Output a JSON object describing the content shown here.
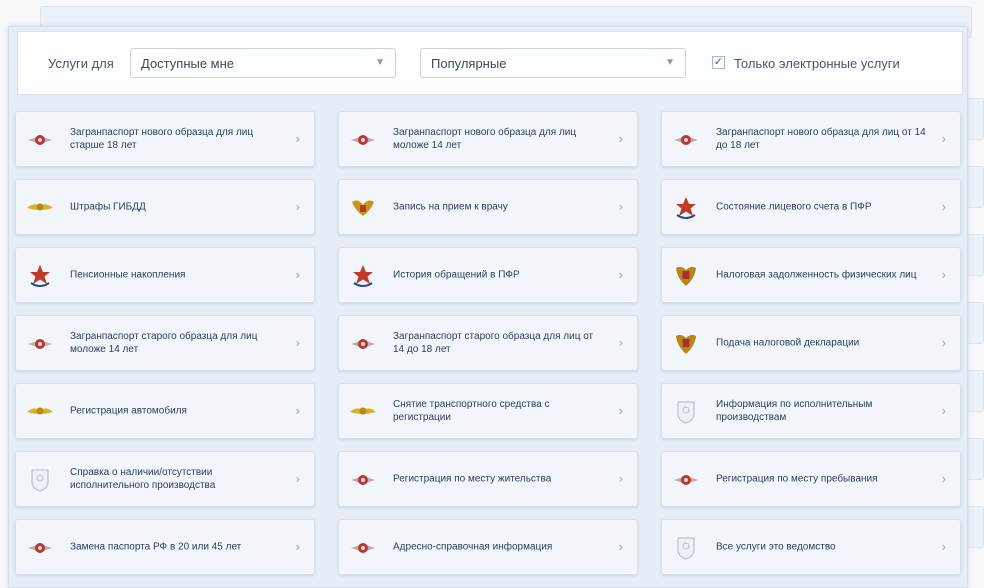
{
  "filter": {
    "label": "Услуги для",
    "audience": "Доступные мне",
    "sort": "Популярные",
    "electronic_only_checked": true,
    "electronic_only_label": "Только электронные услуги"
  },
  "services": [
    {
      "label": "Загранпаспорт нового образца для лиц старше 18 лет",
      "icon": "fms-emblem-icon"
    },
    {
      "label": "Загранпаспорт нового образца для лиц моложе 14 лет",
      "icon": "fms-emblem-icon"
    },
    {
      "label": "Загранпаспорт нового образца для лиц от 14 до 18 лет",
      "icon": "fms-emblem-icon"
    },
    {
      "label": "Штрафы ГИБДД",
      "icon": "mvd-emblem-icon"
    },
    {
      "label": "Запись на прием к врачу",
      "icon": "eagle-emblem-icon"
    },
    {
      "label": "Состояние лицевого счета в ПФР",
      "icon": "pfr-emblem-icon"
    },
    {
      "label": "Пенсионные накопления",
      "icon": "pfr-emblem-icon"
    },
    {
      "label": "История обращений в ПФР",
      "icon": "pfr-emblem-icon"
    },
    {
      "label": "Налоговая задолженность физических лиц",
      "icon": "fns-emblem-icon"
    },
    {
      "label": "Загранпаспорт старого образца для лиц моложе 14 лет",
      "icon": "fms-emblem-icon"
    },
    {
      "label": "Загранпаспорт старого образца для лиц от 14 до 18 лет",
      "icon": "fms-emblem-icon"
    },
    {
      "label": "Подача налоговой декларации",
      "icon": "fns-emblem-icon"
    },
    {
      "label": "Регистрация автомобиля",
      "icon": "mvd-emblem-icon"
    },
    {
      "label": "Снятие транспортного средства с регистрации",
      "icon": "mvd-emblem-icon"
    },
    {
      "label": "Информация по исполнительным производствам",
      "icon": "fssp-emblem-icon"
    },
    {
      "label": "Справка о наличии/отсутствии исполнительного производства",
      "icon": "fssp-emblem-icon"
    },
    {
      "label": "Регистрация по месту жительства",
      "icon": "fms-emblem-icon"
    },
    {
      "label": "Регистрация по месту пребывания",
      "icon": "fms-emblem-icon"
    },
    {
      "label": "Замена паспорта РФ в 20 или 45 лет",
      "icon": "fms-emblem-icon"
    },
    {
      "label": "Адресно-справочная информация",
      "icon": "fms-emblem-icon"
    },
    {
      "label": "Все услуги это ведомство",
      "icon": "fssp-emblem-icon"
    }
  ],
  "chevron": "›",
  "colors": {
    "accent": "#2a5f9e",
    "tile_bg": "#f2f6fb",
    "panel_bg": "#e6edf5"
  }
}
